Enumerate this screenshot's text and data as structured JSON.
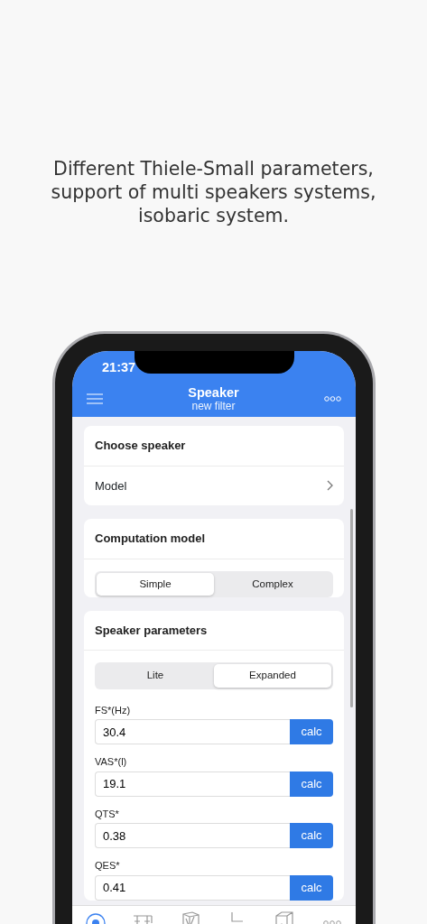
{
  "headline": "Different Thiele-Small parameters,\nsupport of multi speakers systems,\nisobaric system.",
  "status_bar": {
    "time": "21:37"
  },
  "header": {
    "title": "Speaker",
    "subtitle": "new filter"
  },
  "sections": [
    {
      "kind": "link",
      "title": "Choose speaker",
      "row_label": "Model"
    },
    {
      "kind": "segmented",
      "title": "Computation model",
      "options": [
        {
          "label": "Simple",
          "selected": true
        },
        {
          "label": "Complex",
          "selected": false
        }
      ]
    },
    {
      "kind": "segmented",
      "title": "Speaker parameters",
      "options": [
        {
          "label": "Lite",
          "selected": false
        },
        {
          "label": "Expanded",
          "selected": true
        }
      ],
      "fields": [
        {
          "label": "FS*(Hz)",
          "value": "30.4",
          "button": "calc"
        },
        {
          "label": "VAS*(l)",
          "value": "19.1",
          "button": "calc"
        },
        {
          "label": "QTS*",
          "value": "0.38",
          "button": "calc"
        },
        {
          "label": "QES*",
          "value": "0.41",
          "button": "calc"
        }
      ]
    }
  ],
  "tabs": [
    {
      "kind": "speaker",
      "selected": true
    },
    {
      "kind": "filter",
      "selected": false
    },
    {
      "kind": "box",
      "selected": false
    },
    {
      "kind": "graph",
      "selected": false
    },
    {
      "kind": "cabinet",
      "selected": false
    },
    {
      "kind": "more",
      "selected": false
    }
  ]
}
